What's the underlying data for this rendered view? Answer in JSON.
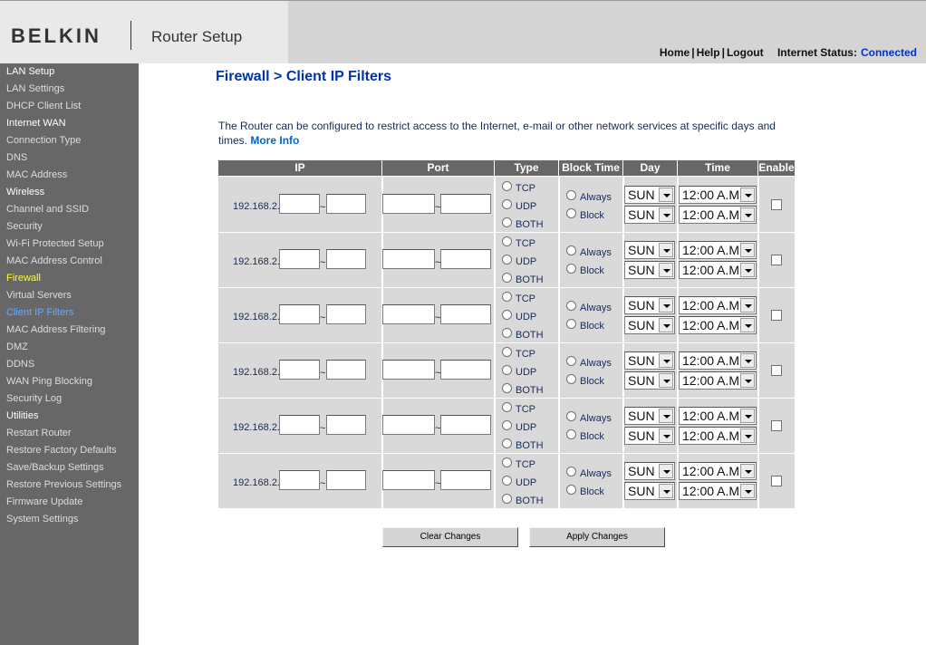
{
  "header": {
    "logo": "BELKIN",
    "app_title": "Router Setup",
    "nav": {
      "home": "Home",
      "help": "Help",
      "logout": "Logout",
      "sep": "|"
    },
    "status_label": "Internet Status:",
    "status_value": "Connected"
  },
  "sidebar": {
    "items": [
      {
        "label": "LAN Setup",
        "type": "heading"
      },
      {
        "label": "LAN Settings",
        "type": "link"
      },
      {
        "label": "DHCP Client List",
        "type": "link"
      },
      {
        "label": "Internet WAN",
        "type": "heading"
      },
      {
        "label": "Connection Type",
        "type": "link"
      },
      {
        "label": "DNS",
        "type": "link"
      },
      {
        "label": "MAC Address",
        "type": "link"
      },
      {
        "label": "Wireless",
        "type": "heading"
      },
      {
        "label": "Channel and SSID",
        "type": "link"
      },
      {
        "label": "Security",
        "type": "link"
      },
      {
        "label": "Wi-Fi Protected Setup",
        "type": "link"
      },
      {
        "label": "MAC Address Control",
        "type": "link"
      },
      {
        "label": "Firewall",
        "type": "section-active"
      },
      {
        "label": "Virtual Servers",
        "type": "link"
      },
      {
        "label": "Client IP Filters",
        "type": "current"
      },
      {
        "label": "MAC Address Filtering",
        "type": "link"
      },
      {
        "label": "DMZ",
        "type": "link"
      },
      {
        "label": "DDNS",
        "type": "link"
      },
      {
        "label": "WAN Ping Blocking",
        "type": "link"
      },
      {
        "label": "Security Log",
        "type": "link"
      },
      {
        "label": "Utilities",
        "type": "heading"
      },
      {
        "label": "Restart Router",
        "type": "link"
      },
      {
        "label": "Restore Factory Defaults",
        "type": "link"
      },
      {
        "label": "Save/Backup Settings",
        "type": "link"
      },
      {
        "label": "Restore Previous Settings",
        "type": "link"
      },
      {
        "label": "Firmware Update",
        "type": "link"
      },
      {
        "label": "System Settings",
        "type": "link"
      }
    ]
  },
  "main": {
    "title": "Firewall > Client IP Filters",
    "description": "The Router can be configured to restrict access to the Internet, e-mail or other network services at specific days and times.",
    "more_info": "More Info"
  },
  "table": {
    "headers": [
      "IP",
      "Port",
      "Type",
      "Block Time",
      "Day",
      "Time",
      "Enable"
    ],
    "ip_prefix": "192.168.2.",
    "tilde": "~",
    "type_options": [
      "TCP",
      "UDP",
      "BOTH"
    ],
    "block_options": [
      "Always",
      "Block"
    ],
    "rows": [
      {
        "day_start": "SUN",
        "day_end": "SUN",
        "time_start": "12:00 A.M.",
        "time_end": "12:00 A.M."
      },
      {
        "day_start": "SUN",
        "day_end": "SUN",
        "time_start": "12:00 A.M.",
        "time_end": "12:00 A.M."
      },
      {
        "day_start": "SUN",
        "day_end": "SUN",
        "time_start": "12:00 A.M.",
        "time_end": "12:00 A.M."
      },
      {
        "day_start": "SUN",
        "day_end": "SUN",
        "time_start": "12:00 A.M.",
        "time_end": "12:00 A.M."
      },
      {
        "day_start": "SUN",
        "day_end": "SUN",
        "time_start": "12:00 A.M.",
        "time_end": "12:00 A.M."
      },
      {
        "day_start": "SUN",
        "day_end": "SUN",
        "time_start": "12:00 A.M.",
        "time_end": "12:00 A.M."
      }
    ]
  },
  "buttons": {
    "clear": "Clear Changes",
    "apply": "Apply Changes"
  }
}
